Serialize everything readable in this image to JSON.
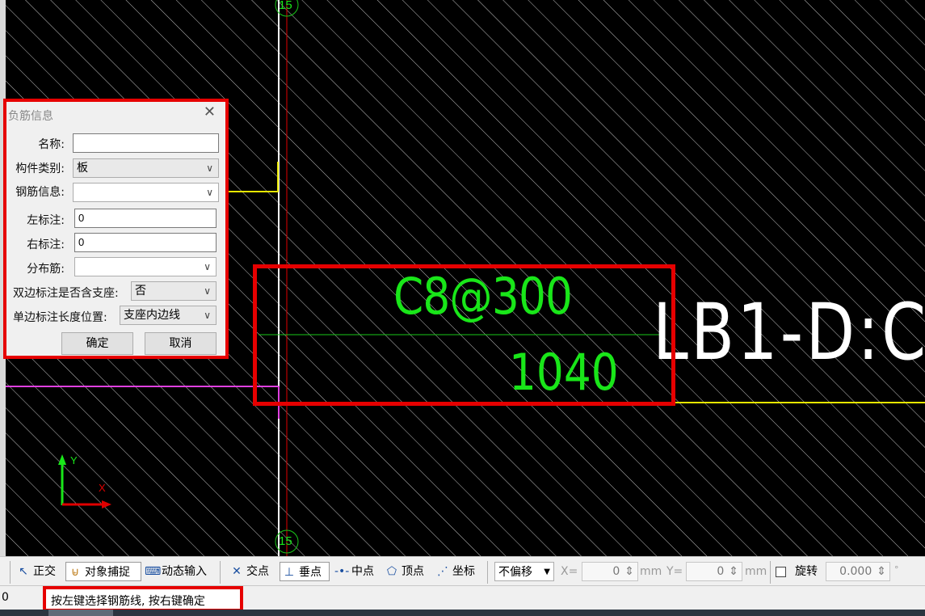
{
  "dialog": {
    "title": "负筋信息",
    "name_label": "名称:",
    "name_value": "",
    "category_label": "构件类别:",
    "category_value": "板",
    "rebar_info_label": "钢筋信息:",
    "rebar_info_value": "",
    "left_mark_label": "左标注:",
    "left_mark_value": "0",
    "right_mark_label": "右标注:",
    "right_mark_value": "0",
    "dist_rebar_label": "分布筋:",
    "dist_rebar_value": "",
    "double_side_label": "双边标注是否含支座:",
    "double_side_value": "否",
    "single_side_label": "单边标注长度位置:",
    "single_side_value": "支座内边线",
    "ok_label": "确定",
    "cancel_label": "取消"
  },
  "canvas": {
    "rebar_spec": "C8@300",
    "rebar_length": "1040",
    "slab_label": "LB1-D:C",
    "axis_top": "15",
    "axis_bottom": "15",
    "ucs_y": "Y",
    "ucs_x": "X"
  },
  "toolbar": {
    "ortho": "正交",
    "osnap": "对象捕捉",
    "dyn_input": "动态输入",
    "intersection": "交点",
    "perpendicular": "垂点",
    "midpoint": "中点",
    "vertex": "顶点",
    "coordinate": "坐标",
    "offset_mode": "不偏移",
    "x_label": "X=",
    "x_value": "0",
    "x_unit": "mm",
    "y_label": "Y=",
    "y_value": "0",
    "y_unit": "mm",
    "rotate_label": "旋转",
    "rotate_value": "0.000",
    "degree_symbol": "°"
  },
  "status": {
    "left_value": "0",
    "prompt": "按左键选择钢筋线, 按右键确定"
  },
  "colors": {
    "highlight": "#e60000",
    "rebar_text": "#19e619",
    "background": "#000000"
  }
}
